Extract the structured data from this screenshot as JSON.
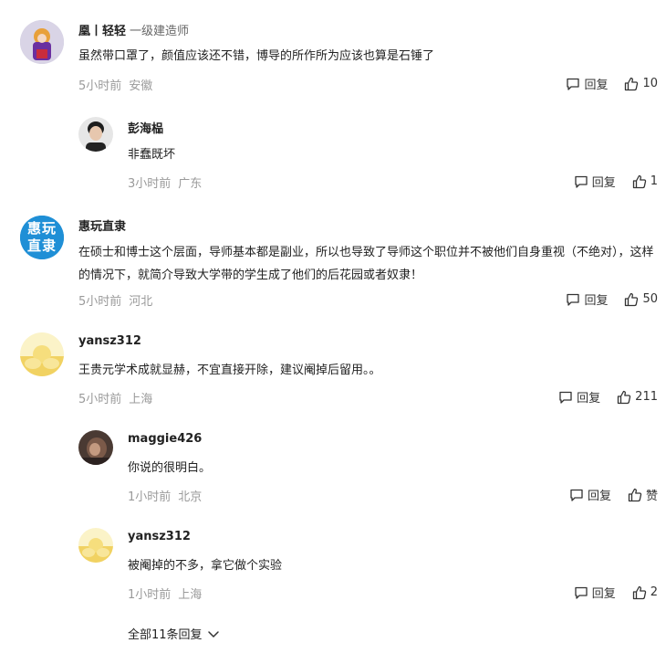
{
  "comments": [
    {
      "name": "凰丨轻轻",
      "title": "一级建造师",
      "text": "虽然带口罩了，颜值应该还不错，博导的所作所为应该也算是石锤了",
      "time": "5小时前",
      "location": "安徽",
      "reply": "回复",
      "likes": "10"
    },
    {
      "name": "彭海榀",
      "text": "非蠢既坏",
      "time": "3小时前",
      "location": "广东",
      "reply": "回复",
      "likes": "1"
    },
    {
      "name": "惠玩直隶",
      "avatar_text": "惠玩直隶",
      "text": "在硕士和博士这个层面，导师基本都是副业，所以也导致了导师这个职位并不被他们自身重视（不绝对），这样的情况下，就简介导致大学带的学生成了他们的后花园或者奴隶！",
      "time": "5小时前",
      "location": "河北",
      "reply": "回复",
      "likes": "50"
    },
    {
      "name": "yansz312",
      "text": "王贵元学术成就显赫，不宜直接开除，建议阉掉后留用。。",
      "time": "5小时前",
      "location": "上海",
      "reply": "回复",
      "likes": "211"
    },
    {
      "name": "maggie426",
      "text": "你说的很明白。",
      "time": "1小时前",
      "location": "北京",
      "reply": "回复",
      "likes": "赞"
    },
    {
      "name": "yansz312",
      "text": "被阉掉的不多，拿它做个实验",
      "time": "1小时前",
      "location": "上海",
      "reply": "回复",
      "likes": "2"
    }
  ],
  "more_replies": "全部11条回复",
  "colors": {
    "meta": "#9a9a9a",
    "text": "#222222"
  }
}
